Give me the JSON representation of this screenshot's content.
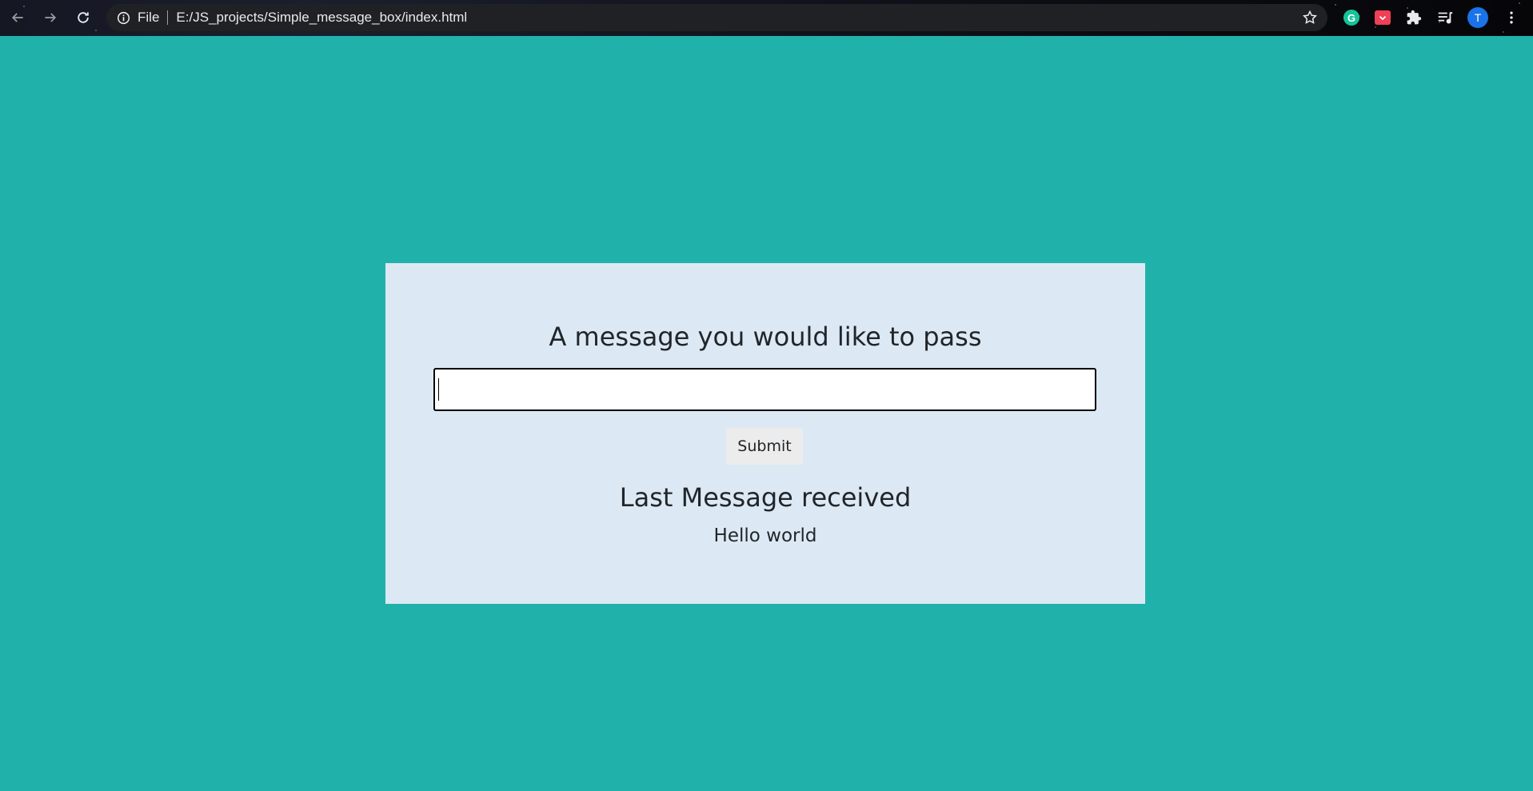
{
  "browser": {
    "scheme_label": "File",
    "url": "E:/JS_projects/Simple_message_box/index.html",
    "icons": {
      "back": "arrow-left-icon",
      "forward": "arrow-right-icon",
      "reload": "reload-icon",
      "info": "info-icon",
      "bookmark": "star-icon",
      "grammarly": "grammarly-icon",
      "pocket": "pocket-icon",
      "extensions": "puzzle-icon",
      "media": "media-control-icon",
      "menu": "kebab-menu-icon"
    },
    "grammarly_letter": "G",
    "profile_initial": "T"
  },
  "page": {
    "background_color": "#20b2aa",
    "card_color": "#dce9f5",
    "heading": "A message you would like to pass",
    "input": {
      "value": "",
      "placeholder": ""
    },
    "submit_label": "Submit",
    "last_message_heading": "Last Message received",
    "last_message": "Hello world"
  }
}
